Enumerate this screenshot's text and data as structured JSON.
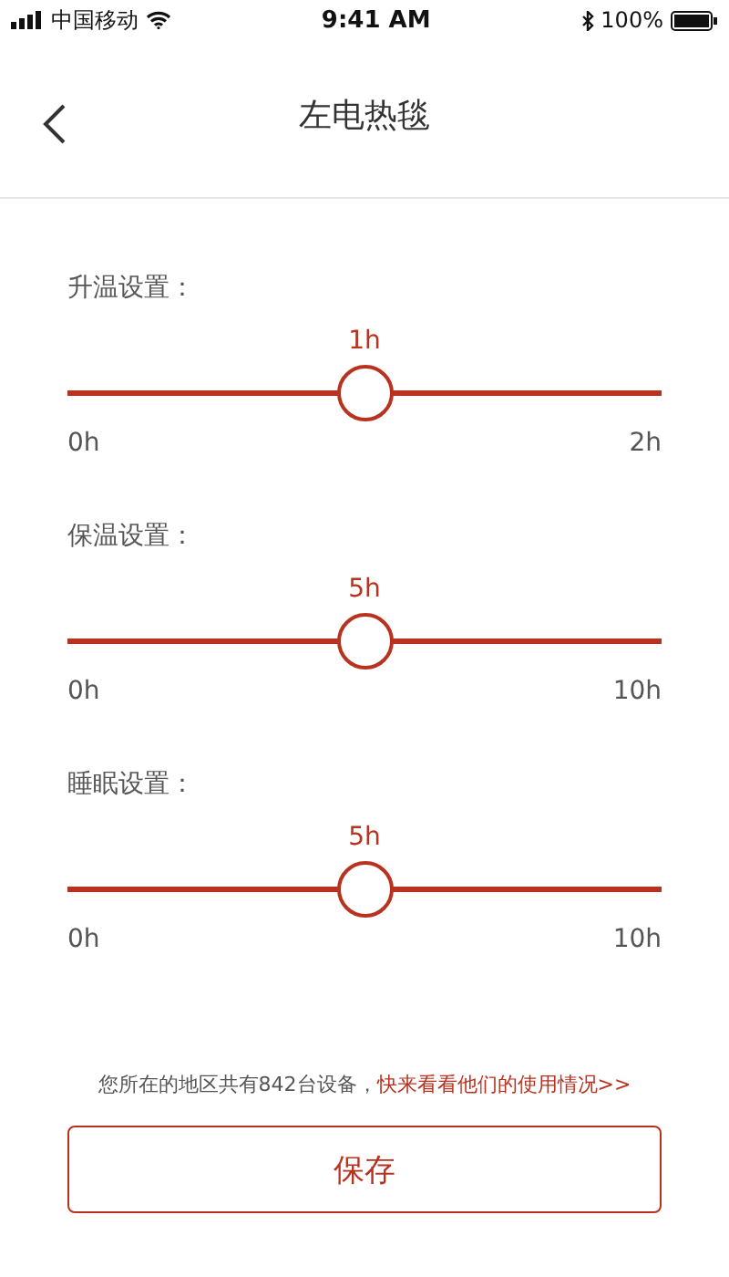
{
  "status_bar": {
    "carrier": "中国移动",
    "time": "9:41 AM",
    "battery": "100%"
  },
  "nav": {
    "title": "左电热毯"
  },
  "settings": [
    {
      "label": "升温设置：",
      "value": "1h",
      "level": 0.5,
      "min": "0h",
      "max": "2h"
    },
    {
      "label": "保温设置：",
      "value": "5h",
      "level": 0.5,
      "min": "0h",
      "max": "10h"
    },
    {
      "label": "睡眠设置：",
      "value": "5h",
      "level": 0.5,
      "min": "0h",
      "max": "10h"
    }
  ],
  "notice": {
    "text": "您所在的地区共有842台设备，",
    "link": "快来看看他们的使用情况>>"
  },
  "save_button": "保存"
}
